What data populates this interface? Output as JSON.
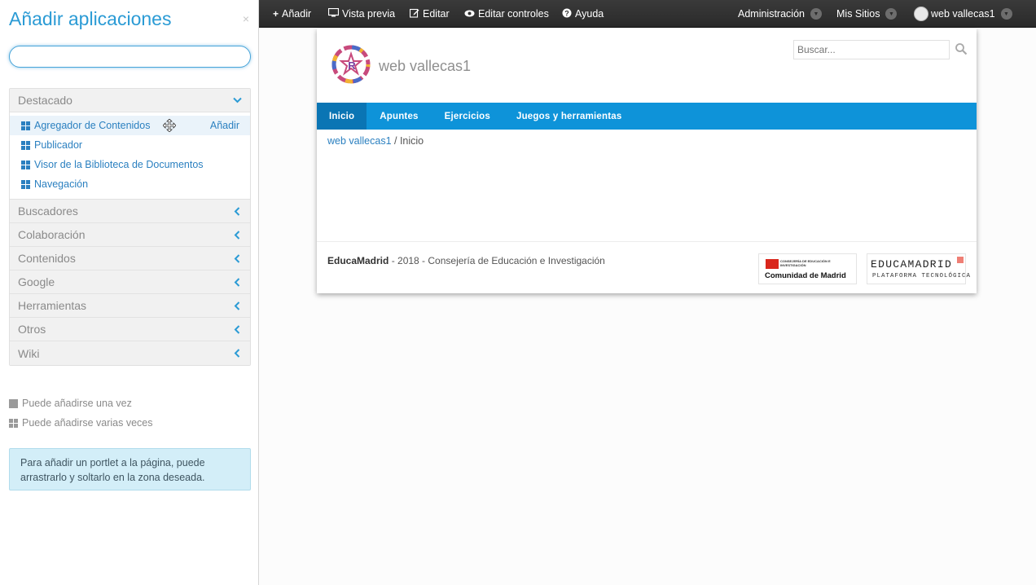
{
  "panel": {
    "title": "Añadir aplicaciones",
    "close_label": "×",
    "search_value": "",
    "categories_expanded": {
      "name": "Destacado",
      "add_label": "Añadir",
      "apps": [
        {
          "label": "Agregador de Contenidos",
          "active": true
        },
        {
          "label": "Publicador"
        },
        {
          "label": "Visor de la Biblioteca de Documentos"
        },
        {
          "label": "Navegación"
        }
      ]
    },
    "categories_collapsed": [
      "Buscadores",
      "Colaboración",
      "Contenidos",
      "Google",
      "Herramientas",
      "Otros",
      "Wiki"
    ],
    "legend": {
      "once": "Puede añadirse una vez",
      "many": "Puede añadirse varias veces"
    },
    "info": "Para añadir un portlet a la página, puede arrastrarlo y soltarlo en la zona deseada."
  },
  "dockbar": {
    "add": "Añadir",
    "preview": "Vista previa",
    "edit": "Editar",
    "edit_controls": "Editar controles",
    "help": "Ayuda",
    "admin": "Administración",
    "my_sites": "Mis Sitios",
    "user": "web vallecas1"
  },
  "site": {
    "name": "web vallecas1",
    "search_placeholder": "Buscar...",
    "nav": [
      {
        "label": "Inicio",
        "active": true
      },
      {
        "label": "Apuntes"
      },
      {
        "label": "Ejercicios"
      },
      {
        "label": "Juegos y herramientas"
      }
    ],
    "breadcrumb": {
      "link": "web vallecas1",
      "separator": " / ",
      "current": "Inicio"
    },
    "footer": {
      "brand": "EducaMadrid",
      "rest": " - 2018 - Consejería de Educación e Investigación",
      "logo_cm_small": "CONSEJERÍA DE EDUCACIÓN E INVESTIGACIÓN",
      "logo_cm_name": "Comunidad de Madrid",
      "logo_em_name": "EDUCAMADRID",
      "logo_em_sub": "PLATAFORMA TECNOLÓGICA"
    }
  },
  "colors": {
    "accent": "#2b9bd5",
    "nav_bg": "#0e93d9",
    "dock_bg": "#2f2f2f"
  }
}
